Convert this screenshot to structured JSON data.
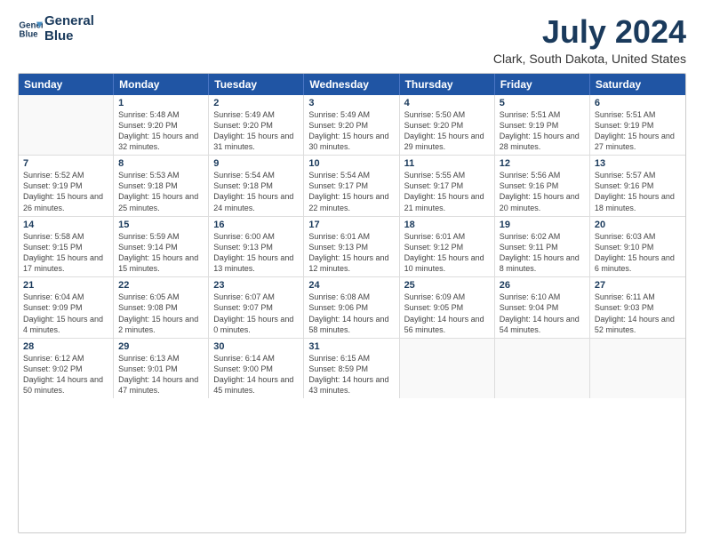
{
  "logo": {
    "line1": "General",
    "line2": "Blue"
  },
  "title": "July 2024",
  "subtitle": "Clark, South Dakota, United States",
  "weekdays": [
    "Sunday",
    "Monday",
    "Tuesday",
    "Wednesday",
    "Thursday",
    "Friday",
    "Saturday"
  ],
  "rows": [
    [
      {
        "day": "",
        "sunrise": "",
        "sunset": "",
        "daylight": ""
      },
      {
        "day": "1",
        "sunrise": "5:48 AM",
        "sunset": "9:20 PM",
        "daylight": "15 hours and 32 minutes."
      },
      {
        "day": "2",
        "sunrise": "5:49 AM",
        "sunset": "9:20 PM",
        "daylight": "15 hours and 31 minutes."
      },
      {
        "day": "3",
        "sunrise": "5:49 AM",
        "sunset": "9:20 PM",
        "daylight": "15 hours and 30 minutes."
      },
      {
        "day": "4",
        "sunrise": "5:50 AM",
        "sunset": "9:20 PM",
        "daylight": "15 hours and 29 minutes."
      },
      {
        "day": "5",
        "sunrise": "5:51 AM",
        "sunset": "9:19 PM",
        "daylight": "15 hours and 28 minutes."
      },
      {
        "day": "6",
        "sunrise": "5:51 AM",
        "sunset": "9:19 PM",
        "daylight": "15 hours and 27 minutes."
      }
    ],
    [
      {
        "day": "7",
        "sunrise": "5:52 AM",
        "sunset": "9:19 PM",
        "daylight": "15 hours and 26 minutes."
      },
      {
        "day": "8",
        "sunrise": "5:53 AM",
        "sunset": "9:18 PM",
        "daylight": "15 hours and 25 minutes."
      },
      {
        "day": "9",
        "sunrise": "5:54 AM",
        "sunset": "9:18 PM",
        "daylight": "15 hours and 24 minutes."
      },
      {
        "day": "10",
        "sunrise": "5:54 AM",
        "sunset": "9:17 PM",
        "daylight": "15 hours and 22 minutes."
      },
      {
        "day": "11",
        "sunrise": "5:55 AM",
        "sunset": "9:17 PM",
        "daylight": "15 hours and 21 minutes."
      },
      {
        "day": "12",
        "sunrise": "5:56 AM",
        "sunset": "9:16 PM",
        "daylight": "15 hours and 20 minutes."
      },
      {
        "day": "13",
        "sunrise": "5:57 AM",
        "sunset": "9:16 PM",
        "daylight": "15 hours and 18 minutes."
      }
    ],
    [
      {
        "day": "14",
        "sunrise": "5:58 AM",
        "sunset": "9:15 PM",
        "daylight": "15 hours and 17 minutes."
      },
      {
        "day": "15",
        "sunrise": "5:59 AM",
        "sunset": "9:14 PM",
        "daylight": "15 hours and 15 minutes."
      },
      {
        "day": "16",
        "sunrise": "6:00 AM",
        "sunset": "9:13 PM",
        "daylight": "15 hours and 13 minutes."
      },
      {
        "day": "17",
        "sunrise": "6:01 AM",
        "sunset": "9:13 PM",
        "daylight": "15 hours and 12 minutes."
      },
      {
        "day": "18",
        "sunrise": "6:01 AM",
        "sunset": "9:12 PM",
        "daylight": "15 hours and 10 minutes."
      },
      {
        "day": "19",
        "sunrise": "6:02 AM",
        "sunset": "9:11 PM",
        "daylight": "15 hours and 8 minutes."
      },
      {
        "day": "20",
        "sunrise": "6:03 AM",
        "sunset": "9:10 PM",
        "daylight": "15 hours and 6 minutes."
      }
    ],
    [
      {
        "day": "21",
        "sunrise": "6:04 AM",
        "sunset": "9:09 PM",
        "daylight": "15 hours and 4 minutes."
      },
      {
        "day": "22",
        "sunrise": "6:05 AM",
        "sunset": "9:08 PM",
        "daylight": "15 hours and 2 minutes."
      },
      {
        "day": "23",
        "sunrise": "6:07 AM",
        "sunset": "9:07 PM",
        "daylight": "15 hours and 0 minutes."
      },
      {
        "day": "24",
        "sunrise": "6:08 AM",
        "sunset": "9:06 PM",
        "daylight": "14 hours and 58 minutes."
      },
      {
        "day": "25",
        "sunrise": "6:09 AM",
        "sunset": "9:05 PM",
        "daylight": "14 hours and 56 minutes."
      },
      {
        "day": "26",
        "sunrise": "6:10 AM",
        "sunset": "9:04 PM",
        "daylight": "14 hours and 54 minutes."
      },
      {
        "day": "27",
        "sunrise": "6:11 AM",
        "sunset": "9:03 PM",
        "daylight": "14 hours and 52 minutes."
      }
    ],
    [
      {
        "day": "28",
        "sunrise": "6:12 AM",
        "sunset": "9:02 PM",
        "daylight": "14 hours and 50 minutes."
      },
      {
        "day": "29",
        "sunrise": "6:13 AM",
        "sunset": "9:01 PM",
        "daylight": "14 hours and 47 minutes."
      },
      {
        "day": "30",
        "sunrise": "6:14 AM",
        "sunset": "9:00 PM",
        "daylight": "14 hours and 45 minutes."
      },
      {
        "day": "31",
        "sunrise": "6:15 AM",
        "sunset": "8:59 PM",
        "daylight": "14 hours and 43 minutes."
      },
      {
        "day": "",
        "sunrise": "",
        "sunset": "",
        "daylight": ""
      },
      {
        "day": "",
        "sunrise": "",
        "sunset": "",
        "daylight": ""
      },
      {
        "day": "",
        "sunrise": "",
        "sunset": "",
        "daylight": ""
      }
    ]
  ]
}
